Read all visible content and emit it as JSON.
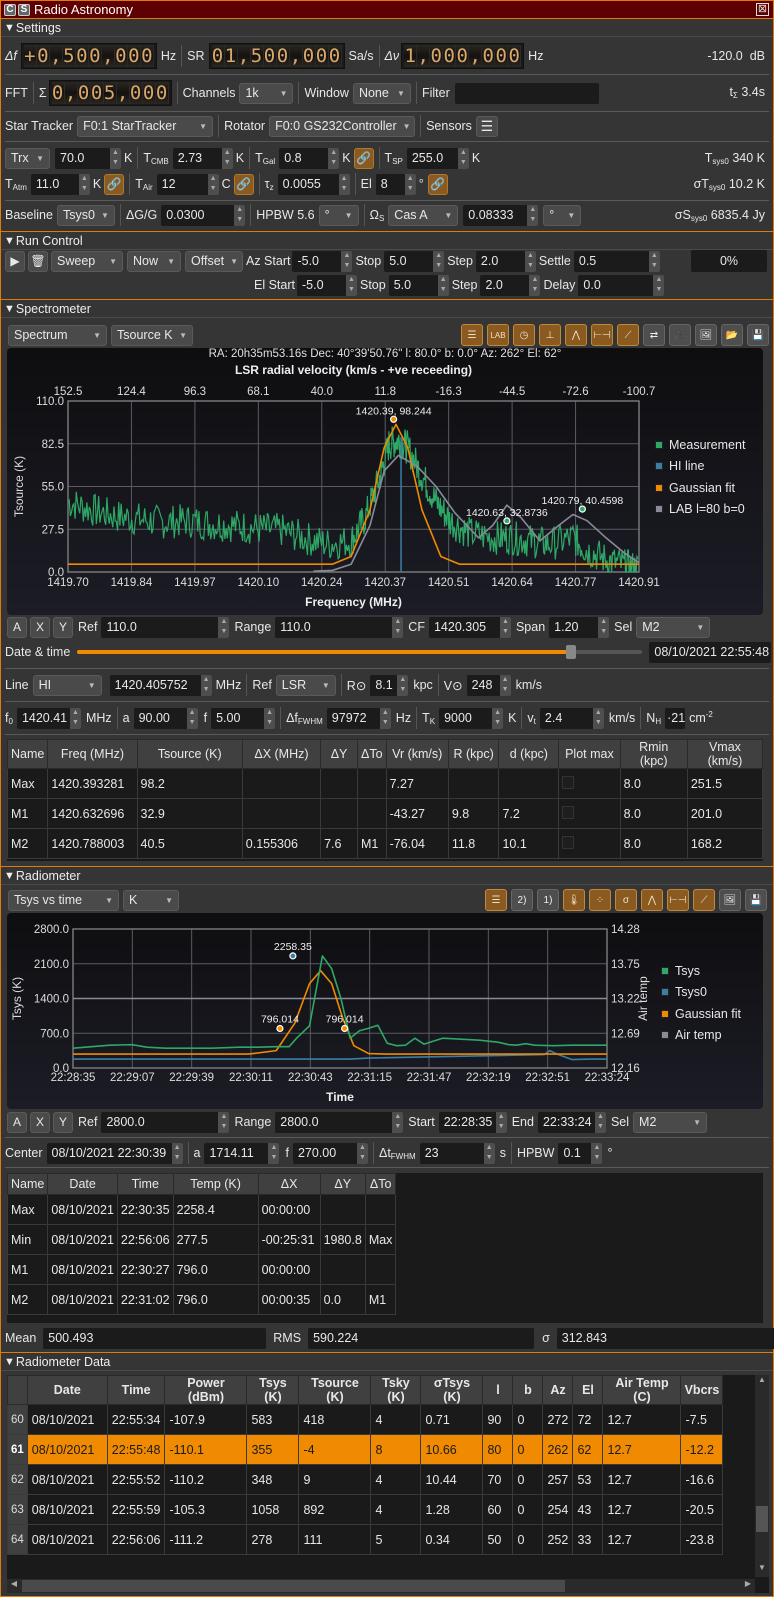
{
  "window": {
    "title": "Radio Astronomy",
    "c_label": "C",
    "s_label": "S",
    "close": "⊠"
  },
  "settings": {
    "header": "Settings",
    "df_label": "Δf",
    "df_digits": "+0,500,000",
    "df_unit": "Hz",
    "sr_label": "SR",
    "sr_digits": "01,500,000",
    "sr_unit": "Sa/s",
    "dv_label": "Δν",
    "dv_digits": "1,000,000",
    "dv_unit": "Hz",
    "power": "-120.0  dB",
    "fft_label": "FFT",
    "sigma": "Σ",
    "fft_digits": "0,005,000",
    "channels_label": "Channels",
    "channels": "1k",
    "window_label": "Window",
    "window": "None",
    "filter_label": "Filter",
    "filter": "",
    "tsigma": "3.4s",
    "tsigma_label": "t",
    "star_tracker_label": "Star Tracker",
    "star_tracker": "F0:1 StarTracker",
    "rotator_label": "Rotator",
    "rotator": "F0:0 GS232Controller",
    "sensors_label": "Sensors",
    "trx_select": "Trx",
    "trx": "70.0",
    "k": "K",
    "tcmb_label": "T",
    "tcmb_sub": "CMB",
    "tcmb": "2.73",
    "tgal_label": "T",
    "tgal_sub": "Gal",
    "tgal": "0.8",
    "tsp_label": "T",
    "tsp_sub": "SP",
    "tsp": "255.0",
    "tsys0_text": "340 K",
    "tsys0_label": "T",
    "tsys0_sub": "sys0",
    "tatm_label": "T",
    "tatm_sub": "Atm",
    "tatm": "11.0",
    "tair_label": "T",
    "tair_sub": "Air",
    "tair": "12",
    "c": "C",
    "tauz_label": "τ",
    "tauz_sub": "z",
    "tauz": "0.0055",
    "el_label": "El",
    "el": "8",
    "deg": "°",
    "sigma_tsys0_label": "σT",
    "sigma_tsys0_sub": "sys0",
    "sigma_tsys0": "10.2 K",
    "baseline_label": "Baseline",
    "baseline": "Tsys0",
    "dgg_label": "ΔG/G",
    "dgg": "0.0300",
    "hpbw_label": "HPBW 5.6",
    "hpbw_unit": "°",
    "omega_label": "Ω",
    "omega_sub": "S",
    "omega_src": "Cas A",
    "omega": "0.08333",
    "omega_unit": "°",
    "sigma_s_label": "σS",
    "sigma_s_sub": "sys0",
    "sigma_s": "6835.4 Jy"
  },
  "run": {
    "header": "Run Control",
    "mode": "Sweep",
    "start": "Now",
    "offset": "Offset",
    "az_start_label": "Az Start",
    "az_start": "-5.0",
    "az_stop_label": "Stop",
    "az_stop": "5.0",
    "az_step_label": "Step",
    "az_step": "2.0",
    "settle_label": "Settle",
    "settle": "0.5",
    "el_start_label": "El Start",
    "el_start": "-5.0",
    "el_stop_label": "Stop",
    "el_stop": "5.0",
    "el_step_label": "Step",
    "el_step": "2.0",
    "delay_label": "Delay",
    "delay": "0.0",
    "progress": "0%"
  },
  "spectrometer": {
    "header": "Spectrometer",
    "chart_select": "Spectrum",
    "units_select": "Tsource K",
    "info": "RA: 20h35m53.16s Dec: 40°39'50.76\" l: 80.0° b: 0.0° Az: 262° El: 62°",
    "a": "A",
    "x": "X",
    "y": "Y",
    "ref_label": "Ref",
    "ref": "110.0",
    "range_label": "Range",
    "range": "110.0",
    "cf_label": "CF",
    "cf": "1420.305",
    "span_label": "Span",
    "span": "1.20",
    "sel_label": "Sel",
    "sel": "M2",
    "datetime_label": "Date & time",
    "datetime": "08/10/2021 22:55:48",
    "datetime_progress": 0.87,
    "line_label": "Line",
    "line": "HI",
    "line_freq": "1420.405752",
    "mhz": "MHz",
    "ref2_label": "Ref",
    "ref2": "LSR",
    "r0_label": "R⊙",
    "r0": "8.1",
    "kpc": "kpc",
    "v0_label": "V⊙",
    "v0": "248",
    "kms": "km/s",
    "f0_label": "f",
    "f0_sub": "0",
    "f0": "1420.41",
    "a_label": "a",
    "a_val": "90.00",
    "f_label": "f",
    "f_val": "5.00",
    "dfwhm_label": "Δf",
    "dfwhm_sub": "FWHM",
    "dfwhm": "97972",
    "hz": "Hz",
    "tk_label": "T",
    "tk_sub": "K",
    "tk": "9000",
    "vt_label": "v",
    "vt_sub": "t",
    "vt": "2.4",
    "nh_label": "N",
    "nh_sub": "H",
    "nh": "21",
    "nh_unit": "cm",
    "table": {
      "headers": [
        "Name",
        "Freq (MHz)",
        "Tsource (K)",
        "ΔX (MHz)",
        "ΔY",
        "ΔTo",
        "Vr (km/s)",
        "R (kpc)",
        "d (kpc)",
        "Plot max",
        "Rmin (kpc)",
        "Vmax (km/s)"
      ],
      "rows": [
        [
          "Max",
          "1420.393281",
          "98.2",
          "",
          "",
          "",
          "7.27",
          "",
          "",
          "",
          "8.0",
          "251.5"
        ],
        [
          "M1",
          "1420.632696",
          "32.9",
          "",
          "",
          "",
          "-43.27",
          "9.8",
          "7.2",
          "",
          "8.0",
          "201.0"
        ],
        [
          "M2",
          "1420.788003",
          "40.5",
          "0.155306",
          "7.6",
          "M1",
          "-76.04",
          "11.8",
          "10.1",
          "",
          "8.0",
          "168.2"
        ]
      ]
    }
  },
  "radiometer": {
    "header": "Radiometer",
    "chart_select": "Tsys vs time",
    "units_select": "K",
    "a": "A",
    "x": "X",
    "y": "Y",
    "ref_label": "Ref",
    "ref": "2800.0",
    "range_label": "Range",
    "range": "2800.0",
    "start_label": "Start",
    "start": "22:28:35",
    "end_label": "End",
    "end": "22:33:24",
    "sel_label": "Sel",
    "sel": "M2",
    "center_label": "Center",
    "center": "08/10/2021 22:30:39",
    "a_label": "a",
    "a_val": "1714.11",
    "f_label": "f",
    "f_val": "270.00",
    "dt_label": "Δt",
    "dt_sub": "FWHM",
    "dt": "23",
    "s": "s",
    "hpbw_label": "HPBW",
    "hpbw": "0.1",
    "deg": "°",
    "table": {
      "headers": [
        "Name",
        "Date",
        "Time",
        "Temp (K)",
        "ΔX",
        "ΔY",
        "ΔTo"
      ],
      "rows": [
        [
          "Max",
          "08/10/2021",
          "22:30:35",
          "2258.4",
          "00:00:00",
          "",
          ""
        ],
        [
          "Min",
          "08/10/2021",
          "22:56:06",
          "277.5",
          "-00:25:31",
          "1980.8",
          "Max"
        ],
        [
          "M1",
          "08/10/2021",
          "22:30:27",
          "796.0",
          "00:00:00",
          "",
          ""
        ],
        [
          "M2",
          "08/10/2021",
          "22:31:02",
          "796.0",
          "00:00:35",
          "0.0",
          "M1"
        ]
      ]
    },
    "mean_label": "Mean",
    "mean": "500.493",
    "rms_label": "RMS",
    "rms": "590.224",
    "sigma_label": "σ",
    "sigma": "312.843"
  },
  "radiometer_data": {
    "header": "Radiometer Data",
    "headers": [
      "",
      "Date",
      "Time",
      "Power (dBm)",
      "Tsys (K)",
      "Tsource (K)",
      "Tsky (K)",
      "σTsys (K)",
      "l",
      "b",
      "Az",
      "El",
      "Air Temp (C)",
      "Vbcrs"
    ],
    "selected_row": 61,
    "rows": [
      [
        "60",
        "08/10/2021",
        "22:55:34",
        "-107.9",
        "583",
        "418",
        "4",
        "0.71",
        "90",
        "0",
        "272",
        "72",
        "12.7",
        "-7.5"
      ],
      [
        "61",
        "08/10/2021",
        "22:55:48",
        "-110.1",
        "355",
        "-4",
        "8",
        "10.66",
        "80",
        "0",
        "262",
        "62",
        "12.7",
        "-12.2"
      ],
      [
        "62",
        "08/10/2021",
        "22:55:52",
        "-110.2",
        "348",
        "9",
        "4",
        "10.44",
        "70",
        "0",
        "257",
        "53",
        "12.7",
        "-16.6"
      ],
      [
        "63",
        "08/10/2021",
        "22:55:59",
        "-105.3",
        "1058",
        "892",
        "4",
        "1.28",
        "60",
        "0",
        "254",
        "43",
        "12.7",
        "-20.5"
      ],
      [
        "64",
        "08/10/2021",
        "22:56:06",
        "-111.2",
        "278",
        "111",
        "5",
        "0.34",
        "50",
        "0",
        "252",
        "33",
        "12.7",
        "-23.8"
      ]
    ]
  },
  "colors": {
    "accent": "#f08a00",
    "measurement": "#2ea866",
    "hi_line": "#3a7ea8",
    "gaussian": "#f08a00",
    "lab": "#8a8a98",
    "title_bg": "#5e0000"
  },
  "chart_data": [
    {
      "type": "line",
      "title": "LSR radial velocity (km/s - +ve receeding)",
      "xlabel": "Frequency (MHz)",
      "ylabel": "Tsource (K)",
      "xlim": [
        1419.7,
        1420.91
      ],
      "ylim": [
        0,
        110
      ],
      "x_ticks": [
        "1419.70",
        "1419.84",
        "1419.97",
        "1420.10",
        "1420.24",
        "1420.37",
        "1420.51",
        "1420.64",
        "1420.77",
        "1420.91"
      ],
      "y_ticks": [
        "0.0",
        "27.5",
        "55.0",
        "82.5",
        "110.0"
      ],
      "top_ticks": [
        "152.5",
        "124.4",
        "96.3",
        "68.1",
        "40.0",
        "11.8",
        "-16.3",
        "-44.5",
        "-72.6",
        "-100.7"
      ],
      "grid": true,
      "legend": "right",
      "series": [
        {
          "name": "Measurement",
          "color": "#2ea866",
          "x": [
            1419.7,
            1419.75,
            1419.8,
            1419.85,
            1419.9,
            1419.95,
            1420.0,
            1420.05,
            1420.1,
            1420.15,
            1420.2,
            1420.25,
            1420.3,
            1420.33,
            1420.36,
            1420.38,
            1420.4,
            1420.42,
            1420.45,
            1420.48,
            1420.51,
            1420.55,
            1420.6,
            1420.64,
            1420.68,
            1420.72,
            1420.77,
            1420.8,
            1420.84,
            1420.88,
            1420.91
          ],
          "y": [
            45,
            40,
            36,
            34,
            32,
            33,
            31,
            30,
            28,
            27,
            22,
            18,
            20,
            35,
            60,
            82,
            85,
            80,
            62,
            45,
            33,
            25,
            22,
            22,
            20,
            18,
            22,
            14,
            8,
            4,
            2
          ]
        },
        {
          "name": "HI line",
          "color": "#3a7ea8",
          "x": [
            1420.405752
          ],
          "y": []
        },
        {
          "name": "Gaussian fit",
          "color": "#f08a00",
          "x": [
            1419.7,
            1420.26,
            1420.3,
            1420.34,
            1420.37,
            1420.395,
            1420.42,
            1420.45,
            1420.49,
            1420.53,
            1420.91
          ],
          "y": [
            5,
            5,
            10,
            40,
            80,
            95,
            80,
            40,
            10,
            5,
            5
          ]
        },
        {
          "name": "LAB l=80 b=0",
          "color": "#8a8a98",
          "x": [
            1420.22,
            1420.26,
            1420.3,
            1420.34,
            1420.37,
            1420.4,
            1420.44,
            1420.48,
            1420.52,
            1420.57,
            1420.6,
            1420.63,
            1420.66,
            1420.7,
            1420.74,
            1420.77,
            1420.8,
            1420.84,
            1420.88,
            1420.91
          ],
          "y": [
            0.5,
            1,
            5,
            30,
            65,
            75,
            68,
            55,
            38,
            22,
            30,
            43,
            35,
            20,
            30,
            37,
            33,
            22,
            12,
            6
          ]
        }
      ],
      "annotations": [
        {
          "label": "1420.39, 98.244",
          "x": 1420.39,
          "y": 98.244
        },
        {
          "label": "1420.63, 32.8736",
          "x": 1420.63,
          "y": 32.8736
        },
        {
          "label": "1420.79, 40.4598",
          "x": 1420.79,
          "y": 40.4598
        }
      ]
    },
    {
      "type": "line",
      "xlabel": "Time",
      "ylabel": "Tsys (K)",
      "y2label": "Air temp",
      "ylim": [
        0,
        2800
      ],
      "y2lim": [
        12.16,
        14.28
      ],
      "x_ticks": [
        "22:28:35",
        "22:29:07",
        "22:29:39",
        "22:30:11",
        "22:30:43",
        "22:31:15",
        "22:31:47",
        "22:32:19",
        "22:32:51",
        "22:33:24"
      ],
      "y_ticks": [
        "0.0",
        "700.0",
        "1400.0",
        "2100.0",
        "2800.0"
      ],
      "y2_ticks": [
        "12.16",
        "12.69",
        "13.22",
        "13.75",
        "14.28"
      ],
      "grid": true,
      "legend": "right",
      "x_seconds": [
        0,
        289
      ],
      "series": [
        {
          "name": "Tsys",
          "color": "#2ea866",
          "x": [
            0,
            10,
            20,
            32,
            40,
            50,
            60,
            75,
            90,
            100,
            110,
            117,
            121,
            128,
            135,
            140,
            145,
            150,
            155,
            160,
            165,
            170,
            175,
            180,
            185,
            190,
            200,
            210,
            220,
            230,
            236,
            240,
            245,
            250,
            260,
            270,
            280,
            289
          ],
          "y": [
            400,
            430,
            460,
            470,
            420,
            400,
            400,
            400,
            420,
            420,
            430,
            430,
            600,
            850,
            2258,
            2000,
            1400,
            600,
            750,
            800,
            860,
            500,
            450,
            460,
            600,
            480,
            600,
            580,
            560,
            520,
            470,
            460,
            490,
            460,
            450,
            460,
            460,
            460
          ]
        },
        {
          "name": "Tsys0",
          "color": "#3a7ea8",
          "x": [
            0,
            150,
            160,
            255,
            258,
            262,
            270,
            280,
            289
          ],
          "y": [
            180,
            180,
            200,
            270,
            350,
            280,
            170,
            180,
            180
          ]
        },
        {
          "name": "Gaussian fit",
          "color": "#f08a00",
          "x": [
            0,
            95,
            110,
            120,
            128,
            134,
            140,
            146,
            152,
            160,
            170,
            289
          ],
          "y": [
            280,
            280,
            350,
            900,
            1700,
            1960,
            1700,
            1000,
            450,
            290,
            280,
            280
          ]
        },
        {
          "name": "Air temp",
          "color": "#8a8a98",
          "x": [
            0,
            289
          ],
          "y2": [
            13.22,
            13.22
          ]
        }
      ],
      "annotations": [
        {
          "label": "2258.35",
          "x": 119,
          "y": 2258.35
        },
        {
          "label": "796.014",
          "x": 112,
          "y": 796.014
        },
        {
          "label": "796.014",
          "x": 147,
          "y": 796.014
        }
      ]
    }
  ]
}
